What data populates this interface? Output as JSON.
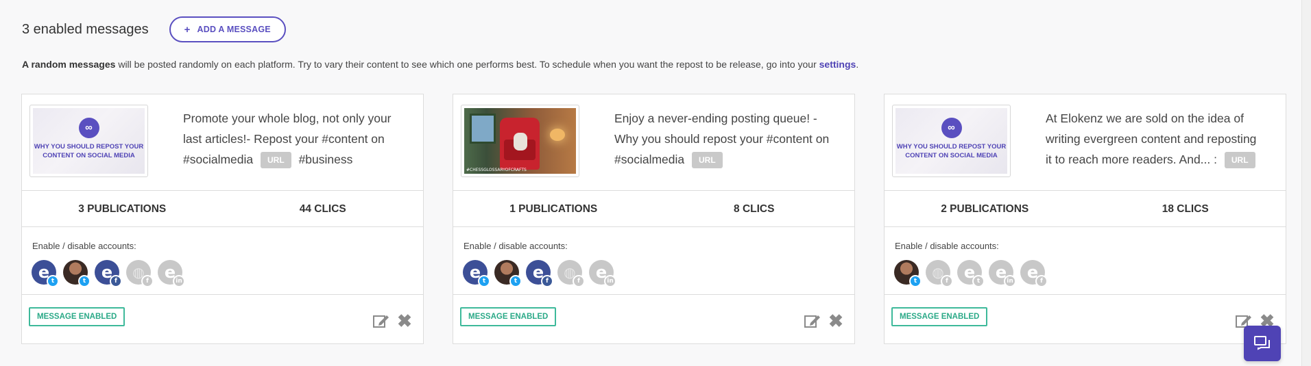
{
  "header": {
    "count_label": "3 enabled messages",
    "add_button_label": "ADD A MESSAGE",
    "add_button_icon": "plus-icon"
  },
  "info": {
    "bold": "A random messages",
    "text": " will be posted randomly on each platform. Try to vary their content to see which one performs best. To schedule when you want the repost to be release, go into your ",
    "link": "settings",
    "end": "."
  },
  "labels": {
    "url": "URL",
    "accounts": "Enable / disable accounts:",
    "enabled": "MESSAGE ENABLED",
    "promo_image_text": "WHY YOU SHOULD REPOST YOUR CONTENT ON SOCIAL MEDIA",
    "scene_caption": "#CHESSGLOSSARYOFCRAFTS"
  },
  "cards": [
    {
      "text_before": "Promote your whole blog, not only your last articles!- Repost your #content on #socialmedia",
      "text_after": "#business",
      "publications": "3 PUBLICATIONS",
      "clics": "44 CLICS",
      "image": "promo"
    },
    {
      "text_before": "Enjoy a never-ending posting queue! - Why you should repost your #content on #socialmedia",
      "text_after": "",
      "publications": "1 PUBLICATIONS",
      "clics": "8 CLICS",
      "image": "scene"
    },
    {
      "text_before": "At Elokenz we are sold on the idea of writing evergreen content and reposting it to reach more readers. And... :",
      "text_after": "",
      "publications": "2 PUBLICATIONS",
      "clics": "18 CLICS",
      "image": "promo"
    }
  ],
  "colors": {
    "accent": "#5a4fc0",
    "enabled_green": "#3db99a",
    "twitter": "#1da1f2",
    "facebook": "#3b5998"
  }
}
